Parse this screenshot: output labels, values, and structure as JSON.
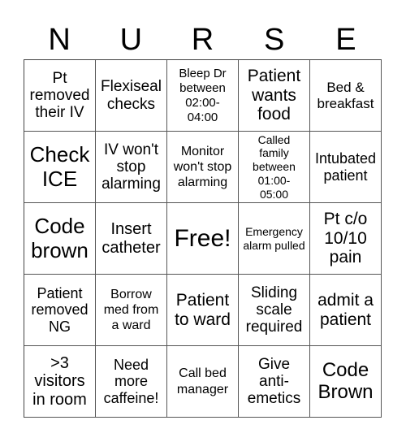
{
  "card": {
    "header_letters": [
      "N",
      "U",
      "R",
      "S",
      "E"
    ],
    "rows": [
      [
        {
          "text": "Pt removed their IV"
        },
        {
          "text": "Flexiseal checks"
        },
        {
          "text": "Bleep Dr between 02:00-04:00"
        },
        {
          "text": "Patient wants food"
        },
        {
          "text": "Bed & breakfast"
        }
      ],
      [
        {
          "text": "Check ICE"
        },
        {
          "text": "IV won't stop alarming"
        },
        {
          "text": "Monitor won't stop alarming"
        },
        {
          "text": "Called family between 01:00-05:00"
        },
        {
          "text": "Intubated patient"
        }
      ],
      [
        {
          "text": "Code brown"
        },
        {
          "text": "Insert catheter"
        },
        {
          "text": "Free!"
        },
        {
          "text": "Emergency alarm pulled"
        },
        {
          "text": "Pt c/o 10/10 pain"
        }
      ],
      [
        {
          "text": "Patient removed NG"
        },
        {
          "text": "Borrow med from a ward"
        },
        {
          "text": "Patient to ward"
        },
        {
          "text": "Sliding scale required"
        },
        {
          "text": "admit a patient"
        }
      ],
      [
        {
          "text": ">3 visitors in room"
        },
        {
          "text": "Need more caffeine!"
        },
        {
          "text": "Call bed manager"
        },
        {
          "text": "Give anti-emetics"
        },
        {
          "text": "Code Brown"
        }
      ]
    ]
  }
}
